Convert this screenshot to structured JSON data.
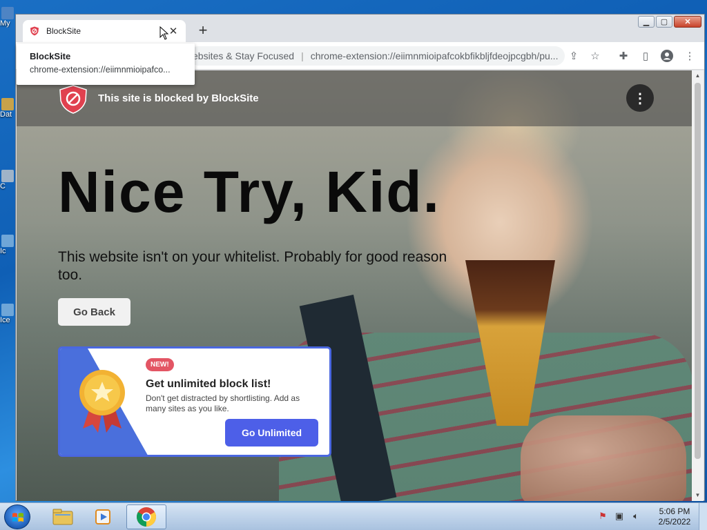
{
  "desktop": {
    "icons": [
      {
        "label": "My"
      },
      {
        "label": "Dat"
      },
      {
        "label": "C"
      },
      {
        "label": "Ic"
      },
      {
        "label": "Ice"
      }
    ]
  },
  "browser": {
    "tab": {
      "title": "BlockSite"
    },
    "omnibox": {
      "page_title": "ebsites & Stay Focused",
      "url": "chrome-extension://eiimnmioipafcokbfikbljfdeojpcgbh/pu..."
    },
    "tooltip": {
      "title": "BlockSite",
      "url": "chrome-extension://eiimnmioipafco..."
    }
  },
  "page": {
    "header_text": "This site is blocked by BlockSite",
    "headline": "Nice Try, Kid.",
    "subline": "This website isn't on your whitelist. Probably for good reason too.",
    "go_back_label": "Go Back",
    "promo": {
      "badge": "NEW!",
      "title": "Get unlimited block list!",
      "description": "Don't get distracted by shortlisting. Add as many sites as you like.",
      "button_label": "Go Unlimited"
    }
  },
  "taskbar": {
    "clock": {
      "time": "5:06 PM",
      "date": "2/5/2022"
    }
  },
  "colors": {
    "accent_blue": "#4d5fe8",
    "badge_red": "#e35564",
    "shield_red": "#e0414f"
  }
}
